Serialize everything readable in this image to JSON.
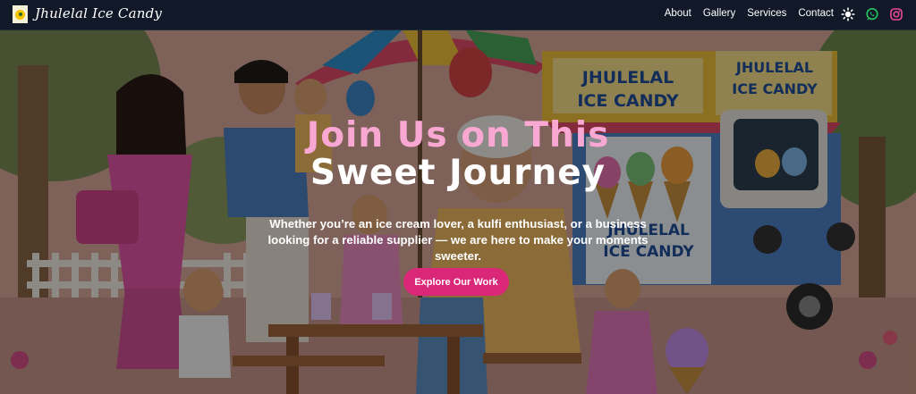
{
  "brand": {
    "name": "Jhulelal Ice Candy",
    "logo_icon": "ice-candy-logo-icon"
  },
  "nav": {
    "links": [
      "About",
      "Gallery",
      "Services",
      "Contact"
    ],
    "icons": [
      {
        "name": "theme-toggle-icon",
        "color": "#ffffff"
      },
      {
        "name": "whatsapp-icon",
        "color": "#22c55e"
      },
      {
        "name": "instagram-icon",
        "color": "#ec4899"
      }
    ]
  },
  "hero": {
    "title_line1": "Join Us on This",
    "title_line2": "Sweet Journey",
    "subtitle": "Whether you’re an ice cream lover, a kulfi enthusiast, or a business looking for a reliable supplier — we are here to make your moments sweeter.",
    "cta_label": "Explore Our Work",
    "background_sign_text_1": "JHULELAL ICE CANDY",
    "background_sign_text_2": "JHULELAL ICE CANDY",
    "background_cart_text": "JHULELAL ICE CANDY"
  },
  "colors": {
    "accent": "#db2777",
    "title_pink": "#f9a8d4",
    "navbar": "#111827"
  }
}
